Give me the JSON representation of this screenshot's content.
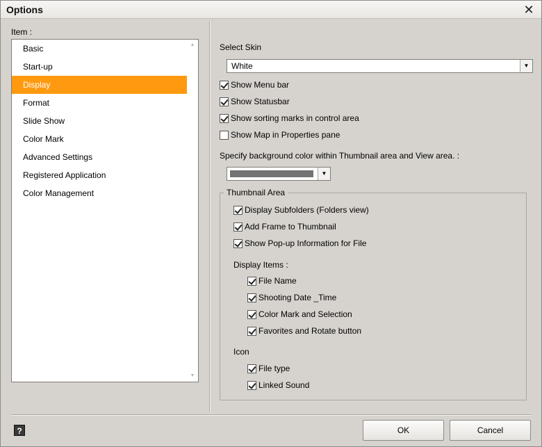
{
  "window": {
    "title": "Options"
  },
  "items_label": "Item :",
  "items": [
    "Basic",
    "Start-up",
    "Display",
    "Format",
    "Slide Show",
    "Color Mark",
    "Advanced Settings",
    "Registered Application",
    "Color Management"
  ],
  "selected_item": "Display",
  "display": {
    "select_skin_label": "Select Skin",
    "skin_value": "White",
    "show_menu_bar": "Show Menu bar",
    "show_statusbar": "Show Statusbar",
    "show_sorting_marks": "Show sorting marks in control area",
    "show_map": "Show Map in Properties pane",
    "bg_color_label": "Specify background color within Thumbnail area and View area. :",
    "bg_color_value": "#737373",
    "thumbnail_area": {
      "title": "Thumbnail Area",
      "display_subfolders": "Display Subfolders  (Folders view)",
      "add_frame": "Add Frame to Thumbnail",
      "show_popup": "Show Pop-up Information for File",
      "display_items_label": "Display Items :",
      "file_name": "File Name",
      "shooting_date": "Shooting Date _Time",
      "color_mark_selection": "Color Mark and Selection",
      "favorites_rotate": "Favorites and Rotate button",
      "icon_label": "Icon",
      "file_type": "File type",
      "linked_sound": "Linked Sound"
    }
  },
  "buttons": {
    "help": "?",
    "ok": "OK",
    "cancel": "Cancel"
  },
  "colors": {
    "selection": "#ff9a10",
    "window_bg": "#d6d3ce"
  }
}
